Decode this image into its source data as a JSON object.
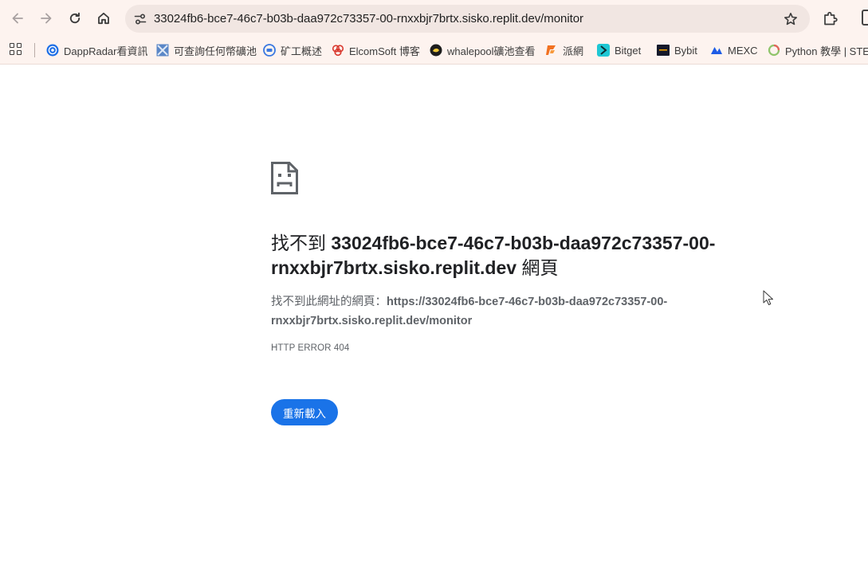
{
  "browser": {
    "url": "33024fb6-bce7-46c7-b03b-daa972c73357-00-rnxxbjr7brtx.sisko.replit.dev/monitor",
    "icons": {
      "back": "arrow-left-icon",
      "forward": "arrow-right-icon",
      "reload": "reload-icon",
      "home": "home-icon",
      "site_info": "tune-icon",
      "bookmark": "star-icon",
      "extensions": "puzzle-icon"
    }
  },
  "bookmarks": [
    {
      "label": "DappRadar看資訊",
      "icon": "dappradar-icon"
    },
    {
      "label": "可查詢任何幣礦池",
      "icon": "mining-pool-icon"
    },
    {
      "label": "矿工概述",
      "icon": "miner-overview-icon"
    },
    {
      "label": "ElcomSoft 博客",
      "icon": "elcomsoft-icon"
    },
    {
      "label": "whalepool礦池查看",
      "icon": "whalepool-icon"
    },
    {
      "label": "派網",
      "icon": "pionex-icon"
    },
    {
      "label": "Bitget",
      "icon": "bitget-icon"
    },
    {
      "label": "Bybit",
      "icon": "bybit-icon"
    },
    {
      "label": "MEXC",
      "icon": "mexc-icon"
    },
    {
      "label": "Python 教學 | STEAM",
      "icon": "python-icon"
    }
  ],
  "error": {
    "title_prefix": "找不到 ",
    "title_host": "33024fb6-bce7-46c7-b03b-daa972c73357-00-rnxxbjr7brtx.sisko.replit.dev",
    "title_suffix": " 網頁",
    "desc_prefix": "找不到此網址的網頁：",
    "desc_url": "https://33024fb6-bce7-46c7-b03b-daa972c73357-00-rnxxbjr7brtx.sisko.replit.dev/monitor",
    "code": "HTTP ERROR 404",
    "reload_label": "重新載入"
  },
  "colors": {
    "toolbar_bg": "#fdf3ef",
    "omnibox_bg": "#f1e6e2",
    "accent": "#1a73e8"
  }
}
